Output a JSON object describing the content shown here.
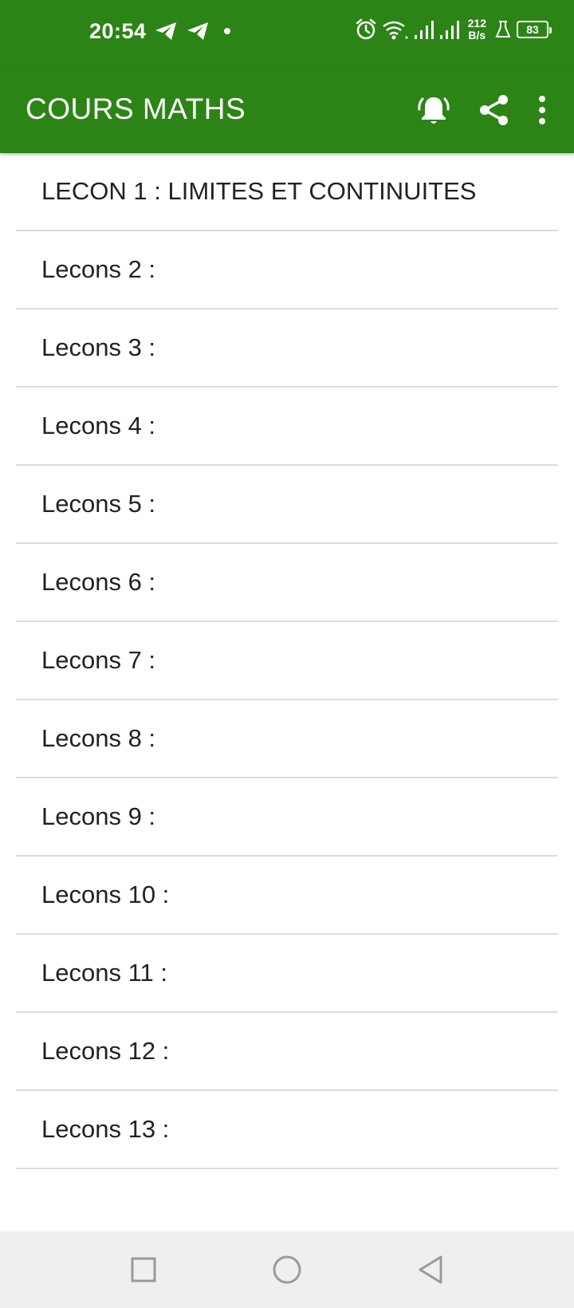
{
  "status_bar": {
    "time": "20:54",
    "notification_icons": [
      "telegram-icon",
      "telegram-icon",
      "dot-icon"
    ],
    "system_icons": [
      "alarm-icon",
      "wifi-icon",
      "signal-icon",
      "signal-icon"
    ],
    "network_speed_value": "212",
    "network_speed_unit": "B/s",
    "battery_level": "83"
  },
  "app_bar": {
    "title": "COURS MATHS",
    "actions": [
      "notification-bell-icon",
      "share-icon",
      "more-vert-icon"
    ],
    "background_color": "#2c8417"
  },
  "lessons": [
    "LECON 1 : LIMITES ET CONTINUITES",
    "Lecons 2 :",
    "Lecons 3 :",
    "Lecons 4 :",
    "Lecons 5 :",
    "Lecons 6 :",
    "Lecons 7 :",
    "Lecons 8 :",
    "Lecons 9 :",
    "Lecons 10 :",
    "Lecons 11 :",
    "Lecons 12 :",
    "Lecons 13 :"
  ],
  "nav_bar": {
    "buttons": [
      "recents-square-icon",
      "home-circle-icon",
      "back-triangle-icon"
    ]
  }
}
